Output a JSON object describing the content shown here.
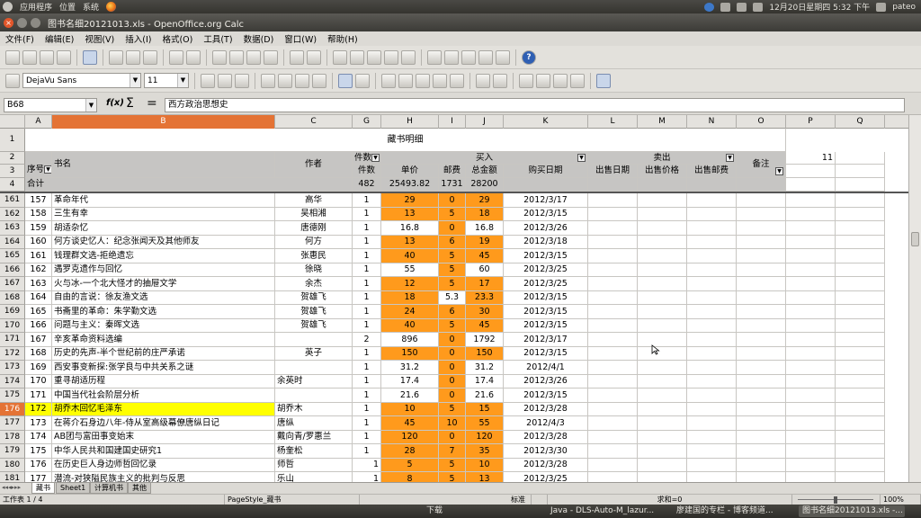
{
  "panel": {
    "menu_apps": "应用程序",
    "menu_places": "位置",
    "menu_system": "系统",
    "datetime": "12月20日星期四 5:32 下午",
    "user": "pateo"
  },
  "window": {
    "title": "图书名细20121013.xls - OpenOffice.org Calc"
  },
  "menubar": [
    "文件(F)",
    "编辑(E)",
    "视图(V)",
    "插入(I)",
    "格式(O)",
    "工具(T)",
    "数据(D)",
    "窗口(W)",
    "帮助(H)"
  ],
  "format": {
    "font": "DejaVu Sans",
    "size": "11"
  },
  "formula": {
    "cell_ref": "B68",
    "content": "西方政治思想史",
    "fx": "f(x)",
    "sigma": "Σ",
    "eq": "="
  },
  "columns": [
    "A",
    "B",
    "C",
    "G",
    "H",
    "I",
    "J",
    "K",
    "L",
    "M",
    "N",
    "O",
    "P",
    "Q"
  ],
  "header": {
    "title": "藏书明细",
    "count_label": "件数",
    "buy_label": "买入",
    "sell_label": "卖出",
    "remark": "备注",
    "p2": "11",
    "seq": "序号",
    "bookname": "书名",
    "author": "作者",
    "price": "单价",
    "postage": "邮费",
    "total": "总金额",
    "buy_date": "购买日期",
    "sell_date": "出售日期",
    "sell_price": "出售价格",
    "sell_postage": "出售邮费",
    "sum_label": "合计",
    "sum_count": "482",
    "sum_price": "25493.82",
    "sum_postage": "1731",
    "sum_total": "28200"
  },
  "rows": [
    {
      "r": "161",
      "a": "157",
      "b": "革命年代",
      "c": "高华",
      "g": "1",
      "h": "29",
      "i": "0",
      "j": "29",
      "k": "2012/3/17"
    },
    {
      "r": "162",
      "a": "158",
      "b": "三生有幸",
      "c": "吴相湘",
      "g": "1",
      "h": "13",
      "i": "5",
      "j": "18",
      "k": "2012/3/15"
    },
    {
      "r": "163",
      "a": "159",
      "b": "胡适杂忆",
      "c": "唐德刚",
      "g": "1",
      "h": "16.8",
      "i": "0",
      "j": "16.8",
      "k": "2012/3/26"
    },
    {
      "r": "164",
      "a": "160",
      "b": "何方谈史忆人：纪念张闻天及其他师友",
      "c": "何方",
      "g": "1",
      "h": "13",
      "i": "6",
      "j": "19",
      "k": "2012/3/18"
    },
    {
      "r": "165",
      "a": "161",
      "b": "钱理群文选-拒绝遗忘",
      "c": "张惠民",
      "g": "1",
      "h": "40",
      "i": "5",
      "j": "45",
      "k": "2012/3/15"
    },
    {
      "r": "166",
      "a": "162",
      "b": "遇罗克遗作与回忆",
      "c": "徐晓",
      "g": "1",
      "h": "55",
      "i": "5",
      "j": "60",
      "k": "2012/3/25"
    },
    {
      "r": "167",
      "a": "163",
      "b": "火与冰-一个北大怪才的抽屉文学",
      "c": "余杰",
      "g": "1",
      "h": "12",
      "i": "5",
      "j": "17",
      "k": "2012/3/25"
    },
    {
      "r": "168",
      "a": "164",
      "b": "自由的言说：徐友渔文选",
      "c": "贺雄飞",
      "g": "1",
      "h": "18",
      "i": "5.3",
      "j": "23.3",
      "k": "2012/3/15"
    },
    {
      "r": "169",
      "a": "165",
      "b": "书斋里的革命：朱学勤文选",
      "c": "贺雄飞",
      "g": "1",
      "h": "24",
      "i": "6",
      "j": "30",
      "k": "2012/3/15"
    },
    {
      "r": "170",
      "a": "166",
      "b": "问题与主义：秦晖文选",
      "c": "贺雄飞",
      "g": "1",
      "h": "40",
      "i": "5",
      "j": "45",
      "k": "2012/3/15"
    },
    {
      "r": "171",
      "a": "167",
      "b": "辛亥革命资料选编",
      "c": "",
      "g": "2",
      "h": "896",
      "i": "0",
      "j": "1792",
      "k": "2012/3/17"
    },
    {
      "r": "172",
      "a": "168",
      "b": "历史的先声-半个世纪前的庄严承诺",
      "c": "英子",
      "g": "1",
      "h": "150",
      "i": "0",
      "j": "150",
      "k": "2012/3/15"
    },
    {
      "r": "173",
      "a": "169",
      "b": "西安事变新探:张学良与中共关系之谜",
      "c": "",
      "g": "1",
      "h": "31.2",
      "i": "0",
      "j": "31.2",
      "k": "2012/4/1"
    },
    {
      "r": "174",
      "a": "170",
      "b": "重寻胡适历程",
      "c": "余英时",
      "g": "1",
      "h": "17.4",
      "i": "0",
      "j": "17.4",
      "k": "2012/3/26"
    },
    {
      "r": "175",
      "a": "171",
      "b": "中国当代社会阶层分析",
      "c": "",
      "g": "1",
      "h": "21.6",
      "i": "0",
      "j": "21.6",
      "k": "2012/3/15"
    },
    {
      "r": "176",
      "a": "172",
      "b": "胡乔木回忆毛泽东",
      "c": "胡乔木",
      "g": "1",
      "h": "10",
      "i": "5",
      "j": "15",
      "k": "2012/3/28"
    },
    {
      "r": "177",
      "a": "173",
      "b": "在蒋介石身边八年-侍从室高级幕僚唐纵日记",
      "c": "唐纵",
      "g": "1",
      "h": "45",
      "i": "10",
      "j": "55",
      "k": "2012/4/3"
    },
    {
      "r": "178",
      "a": "174",
      "b": "AB团与富田事变始末",
      "c": "戴向青/罗惠兰",
      "g": "1",
      "h": "120",
      "i": "0",
      "j": "120",
      "k": "2012/3/28"
    },
    {
      "r": "179",
      "a": "175",
      "b": "中华人民共和国建国史研究1",
      "c": "杨奎松",
      "g": "1",
      "h": "28",
      "i": "7",
      "j": "35",
      "k": "2012/3/30"
    },
    {
      "r": "180",
      "a": "176",
      "b": "在历史巨人身边师哲回忆录",
      "c": "师哲",
      "g": "1",
      "h": "5",
      "i": "5",
      "j": "10",
      "k": "2012/3/28"
    },
    {
      "r": "181",
      "a": "177",
      "b": "潜流-对狭隘民族主义的批判与反思",
      "c": "乐山",
      "g": "1",
      "h": "8",
      "i": "5",
      "j": "13",
      "k": "2012/3/25"
    }
  ],
  "sheet_tabs": [
    "藏书",
    "Sheet1",
    "计算机书",
    "其他"
  ],
  "status": {
    "sheet": "工作表 1 / 4",
    "style": "PageStyle_藏书",
    "mode": "标准",
    "sum": "求和=0",
    "zoom": "100%"
  },
  "taskbar": [
    "下载",
    "Java - DLS-Auto-M_lazur...",
    "廖建国的专栏 - 博客频道...",
    "图书名细20121013.xls -..."
  ]
}
